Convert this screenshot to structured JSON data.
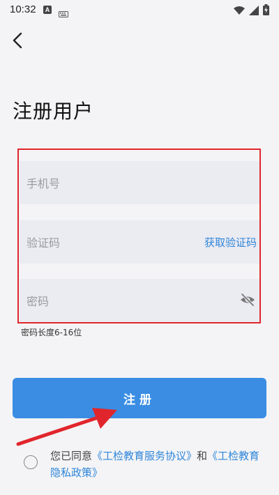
{
  "status_bar": {
    "time": "10:32",
    "notif_letter": "A",
    "icons": [
      "keyboard-icon",
      "wifi-icon",
      "signal-icon",
      "battery-charging-icon"
    ]
  },
  "nav": {
    "back_icon": "chevron-left-icon"
  },
  "page": {
    "title": "注册用户"
  },
  "form": {
    "phone_placeholder": "手机号",
    "code_placeholder": "验证码",
    "get_code_label": "获取验证码",
    "password_placeholder": "密码",
    "password_hint": "密码长度6-16位",
    "eye_icon": "eye-off-icon"
  },
  "register": {
    "label": "注册"
  },
  "agreement": {
    "prefix": "您已同意",
    "service_link": "《工检教育服务协议》",
    "conjunction": "和",
    "privacy_link": "《工检教育隐私政策》"
  },
  "colors": {
    "accent": "#3a8de3",
    "link": "#2f86d9",
    "highlight": "#e0262c",
    "field_bg": "#ebebf2"
  }
}
